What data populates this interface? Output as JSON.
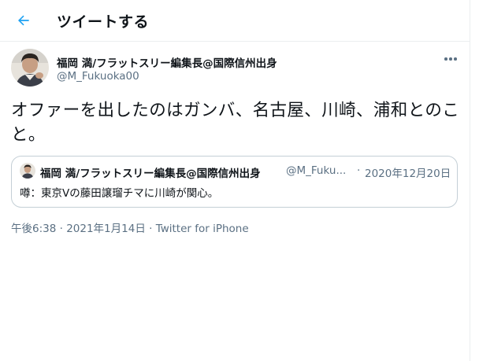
{
  "header": {
    "title": "ツイートする",
    "back_icon": "arrow-left-icon",
    "accent_color": "#1da1f2"
  },
  "tweet": {
    "author_name": "福岡 満/フラットスリー編集長@国際信州出身",
    "author_handle": "@M_Fukuoka00",
    "text": "オファーを出したのはガンバ、名古屋、川崎、浦和とのこと。",
    "more_icon": "more-horizontal-icon",
    "meta": {
      "time": "午後6:38",
      "separator": " · ",
      "date": "2021年1月14日",
      "separator2": " · ",
      "source": "Twitter for iPhone"
    }
  },
  "quote": {
    "author_name": "福岡 満/フラットスリー編集長@国際信州出身",
    "author_handle": "@M_Fuku...",
    "separator": "·",
    "date": "2020年12月20日",
    "text": "噂：東京Vの藤田譲瑠チマに川崎が関心。"
  }
}
